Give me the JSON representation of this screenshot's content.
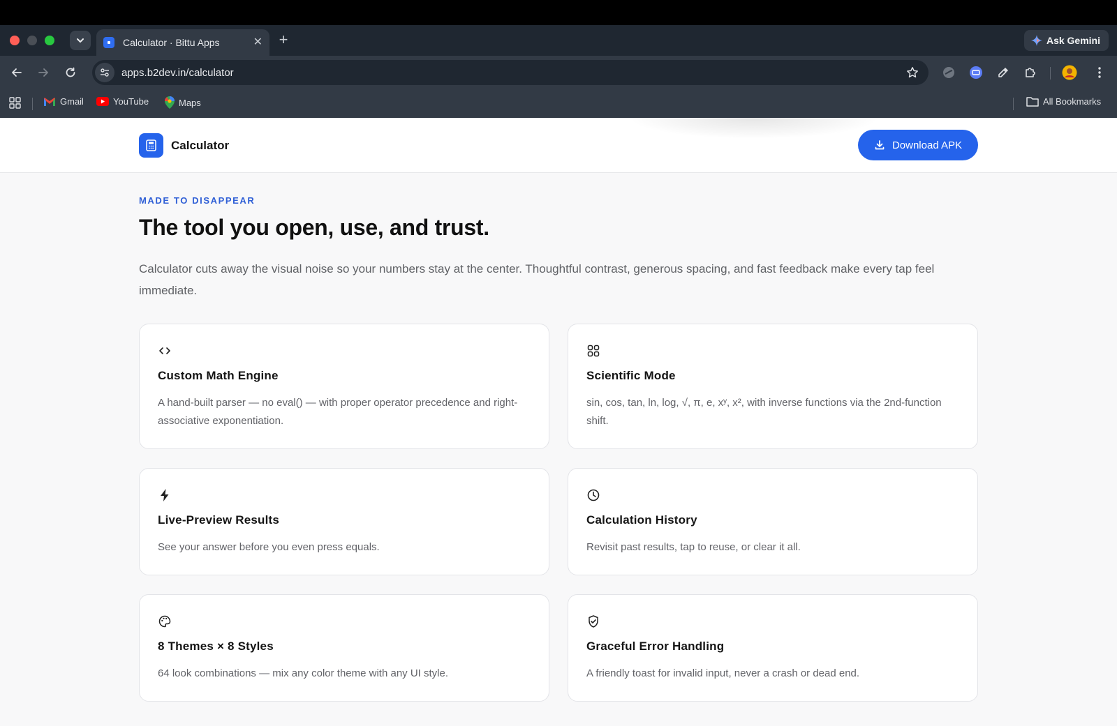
{
  "browser": {
    "tab": {
      "title": "Calculator · Bittu Apps"
    },
    "gemini_label": "Ask Gemini",
    "url": "apps.b2dev.in/calculator",
    "bookmarks": [
      {
        "label": "Gmail"
      },
      {
        "label": "YouTube"
      },
      {
        "label": "Maps"
      }
    ],
    "all_bookmarks_label": "All Bookmarks"
  },
  "site": {
    "brand_name": "Calculator",
    "download_label": "Download APK",
    "accent_color": "#2563eb"
  },
  "hero": {
    "eyebrow": "MADE TO DISAPPEAR",
    "headline": "The tool you open, use, and trust.",
    "lead": "Calculator cuts away the visual noise so your numbers stay at the center. Thoughtful contrast, generous spacing, and fast feedback make every tap feel immediate."
  },
  "features": [
    {
      "icon": "code-icon",
      "title": "Custom Math Engine",
      "description": "A hand-built parser — no eval() — with proper operator precedence and right-associative exponentiation."
    },
    {
      "icon": "grid-icon",
      "title": "Scientific Mode",
      "description": "sin, cos, tan, ln, log, √, π, e, xʸ, x², with inverse functions via the 2nd-function shift."
    },
    {
      "icon": "bolt-icon",
      "title": "Live-Preview Results",
      "description": "See your answer before you even press equals."
    },
    {
      "icon": "clock-icon",
      "title": "Calculation History",
      "description": "Revisit past results, tap to reuse, or clear it all."
    },
    {
      "icon": "palette-icon",
      "title": "8 Themes × 8 Styles",
      "description": "64 look combinations — mix any color theme with any UI style."
    },
    {
      "icon": "shield-check-icon",
      "title": "Graceful Error Handling",
      "description": "A friendly toast for invalid input, never a crash or dead end."
    }
  ]
}
